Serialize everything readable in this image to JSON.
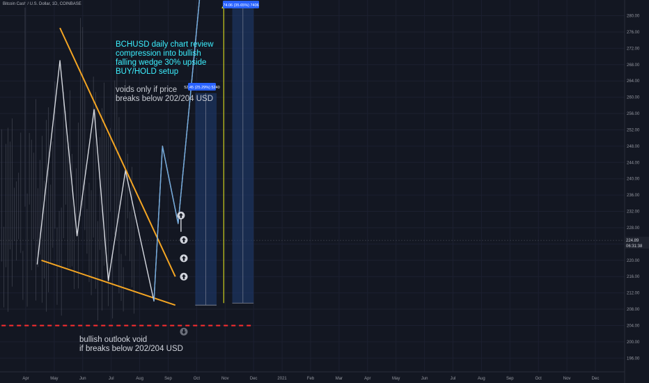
{
  "symbol_title": "Bitcoin Cash / U.S. Dollar, 1D, COINBASE",
  "annotations": {
    "main_idea": [
      "BCHUSD daily chart review",
      "compression into bullish",
      "falling wedge 30% upside",
      "BUY/HOLD setup"
    ],
    "void_note": [
      "voids only if price",
      "breaks below 202/204 USD"
    ],
    "bearish_note": [
      "bullish outlook void",
      "if breaks below 202/204 USD"
    ]
  },
  "measure_badges": {
    "short": "52.45 (25.29%) 5240",
    "long": "74.06 (35.65%) 7406"
  },
  "price_labels": {
    "current": "224.89",
    "countdown": "06:31:38"
  },
  "colors": {
    "background": "#131722",
    "wedge_lines": "#f5a623",
    "support_line": "#ff2e2e",
    "projection_path": "#6fa8dc",
    "target_arrow": "#f2f21a",
    "measure_box": "#1e3a6e",
    "badge": "#2962ff",
    "annotation_cyan": "#3cf0ff"
  },
  "chart_data": {
    "type": "line",
    "title": "",
    "xlabel": "",
    "ylabel": "",
    "ylim": [
      194,
      283
    ],
    "grid": true,
    "x_tick_labels": [
      "Apr",
      "May",
      "Jun",
      "Jul",
      "Aug",
      "Sep",
      "Oct",
      "Nov",
      "Dec",
      "2021",
      "Feb",
      "Mar",
      "Apr",
      "May",
      "Jun",
      "Jul",
      "Aug",
      "Sep",
      "Oct",
      "Nov",
      "Dec"
    ],
    "y_ticks": [
      196,
      200,
      204,
      208,
      212,
      216,
      220,
      224,
      228,
      232,
      236,
      240,
      244,
      248,
      252,
      256,
      260,
      264,
      268,
      272,
      276,
      280
    ],
    "series": [
      {
        "kind": "price_zigzag",
        "points": [
          [
            0.4,
            219
          ],
          [
            1.2,
            269
          ],
          [
            1.8,
            226
          ],
          [
            2.4,
            257
          ],
          [
            2.9,
            215
          ],
          [
            3.5,
            242
          ],
          [
            4.5,
            210
          ],
          [
            4.8,
            248
          ],
          [
            5.35,
            229
          ],
          [
            6.1,
            284
          ]
        ]
      },
      {
        "kind": "projection_segment",
        "points": [
          [
            5.45,
            227
          ],
          [
            5.45,
            231
          ]
        ]
      }
    ],
    "wedge_upper": [
      [
        1.2,
        277
      ],
      [
        5.25,
        216
      ]
    ],
    "wedge_lower": [
      [
        0.55,
        220
      ],
      [
        5.25,
        209
      ]
    ],
    "support_level": 204,
    "measure_short": {
      "x": [
        5.95,
        6.7
      ],
      "y": [
        209,
        261
      ],
      "delta": 52.45,
      "pct": 25.29
    },
    "measure_long": {
      "x": [
        7.25,
        8
      ],
      "y": [
        209.5,
        283
      ],
      "delta": 74.06,
      "pct": 35.65
    },
    "target_arrow": {
      "x": 6.95,
      "y": [
        209.5,
        283
      ]
    },
    "up_arrows": [
      [
        5.45,
        231
      ],
      [
        5.55,
        225
      ],
      [
        5.55,
        220.5
      ],
      [
        5.55,
        216
      ]
    ],
    "down_arrow": [
      5.55,
      202.5
    ]
  }
}
